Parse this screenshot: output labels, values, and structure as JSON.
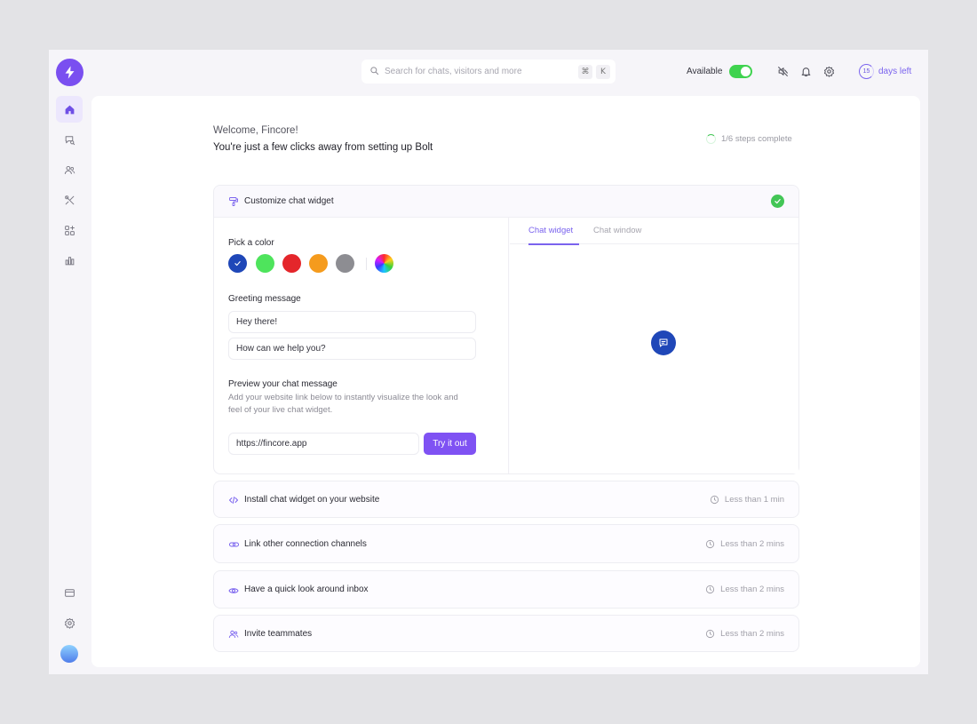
{
  "topbar": {
    "search_placeholder": "Search for chats, visitors and more",
    "shortcut_mod": "⌘",
    "shortcut_key": "K",
    "status_label": "Available",
    "status_on": true,
    "trial_days": "15",
    "trial_label": "days left"
  },
  "sidebar": {
    "items": [
      {
        "name": "home",
        "icon": "home-icon",
        "active": true
      },
      {
        "name": "search-chats",
        "icon": "chat-search-icon"
      },
      {
        "name": "contacts",
        "icon": "users-icon"
      },
      {
        "name": "automation",
        "icon": "tools-icon"
      },
      {
        "name": "apps",
        "icon": "apps-add-icon"
      },
      {
        "name": "reports",
        "icon": "bar-chart-icon"
      }
    ],
    "bottom": [
      {
        "name": "billing",
        "icon": "card-icon"
      },
      {
        "name": "settings",
        "icon": "gear-icon"
      }
    ]
  },
  "main": {
    "welcome": "Welcome, Fincore!",
    "subtitle": "You're just a few clicks away from setting up Bolt",
    "steps_progress": "1/6 steps complete"
  },
  "widget_card": {
    "title": "Customize chat widget",
    "completed": true,
    "pick_color_label": "Pick a color",
    "colors": [
      "#1f47b8",
      "#4ee45c",
      "#e4262b",
      "#f59b1d",
      "#8d8d92"
    ],
    "selected_color": "#1f47b8",
    "greeting_label": "Greeting message",
    "greeting_line1": "Hey there!",
    "greeting_line2": "How can we help you?",
    "preview_label": "Preview your chat message",
    "preview_help": "Add your website link below to instantly visualize the look and feel of your live chat widget.",
    "url_value": "https://fincore.app",
    "try_button": "Try it out",
    "tabs": [
      "Chat widget",
      "Chat window"
    ],
    "active_tab": "Chat widget"
  },
  "steps": [
    {
      "title": "Install chat widget on your website",
      "time": "Less than 1 min",
      "icon": "code-icon"
    },
    {
      "title": "Link other connection channels",
      "time": "Less than 2 mins",
      "icon": "link-icon"
    },
    {
      "title": "Have a quick look around inbox",
      "time": "Less than 2 mins",
      "icon": "eye-icon"
    },
    {
      "title": "Invite teammates",
      "time": "Less than 2 mins",
      "icon": "users-icon"
    }
  ],
  "colors": {
    "accent": "#7a4ff0",
    "success": "#43c656"
  }
}
